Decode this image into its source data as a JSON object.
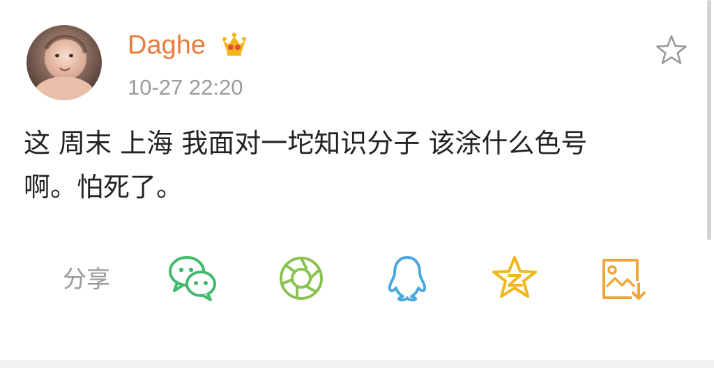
{
  "post": {
    "username": "Daghe",
    "timestamp": "10-27 22:20",
    "text_line1": "这 周末 上海 我面对一坨知识分子 该涂什么色号",
    "text_line2": "啊。怕死了。"
  },
  "share": {
    "label": "分享",
    "targets": [
      "wechat-icon",
      "moments-icon",
      "qq-icon",
      "qzone-icon",
      "save-image-icon"
    ]
  },
  "icons": {
    "badge": "crown-icon",
    "favorite": "star-outline-icon"
  },
  "colors": {
    "username": "#eb7b3a",
    "meta_text": "#9a9a9a",
    "body_text": "#222222",
    "wechat": "#3fba6b",
    "moments": "#8ac251",
    "qq": "#4aa8e0",
    "qzone": "#f2b61a",
    "save": "#f0a63c"
  }
}
